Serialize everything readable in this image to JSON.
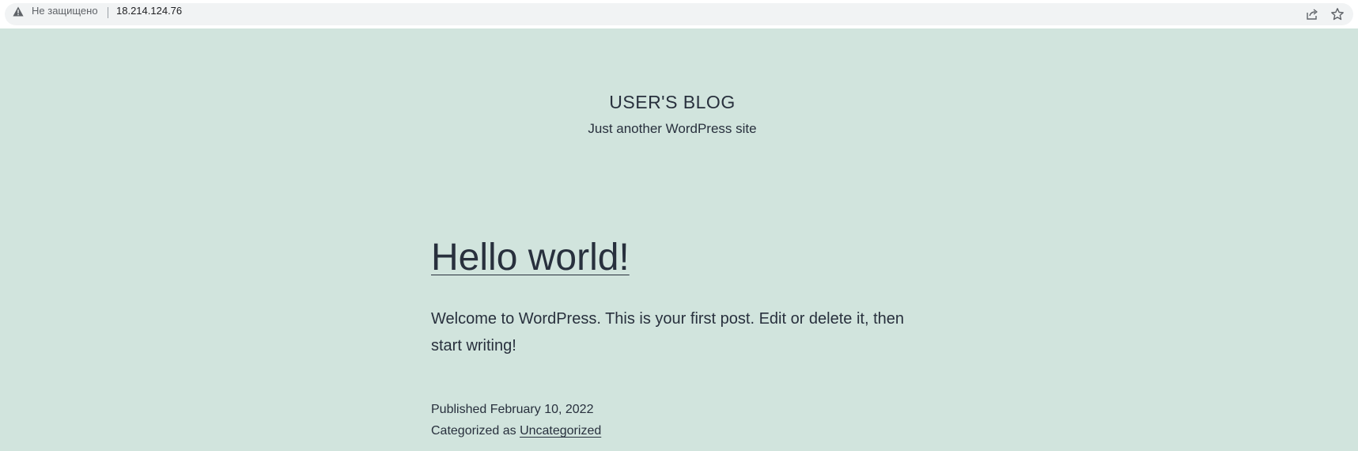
{
  "browser": {
    "security_label": "Не защищено",
    "url": "18.214.124.76",
    "icons": {
      "security": "warning-triangle",
      "share": "share-arrow",
      "bookmark": "star-outline"
    }
  },
  "site": {
    "title": "USER'S BLOG",
    "description": "Just another WordPress site"
  },
  "post": {
    "title": "Hello world!",
    "content": "Welcome to WordPress. This is your first post. Edit or delete it, then start writing!",
    "published_label": "Published February 10, 2022",
    "categorized_prefix": "Categorized as ",
    "category": "Uncategorized"
  },
  "colors": {
    "background": "#d1e4dd",
    "text": "#28303d"
  }
}
